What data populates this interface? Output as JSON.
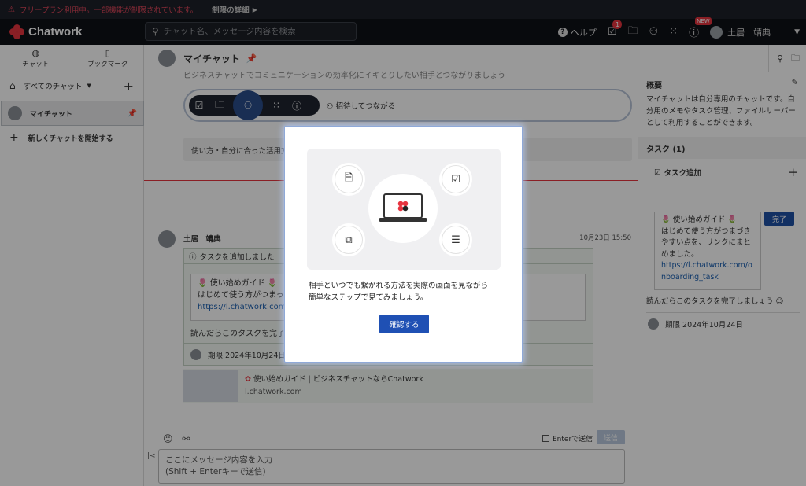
{
  "banner": {
    "warning": "フリープラン利用中。一部機能が制限されています。",
    "detail_link": "制限の詳細"
  },
  "topbar": {
    "app_name": "Chatwork",
    "search_placeholder": "チャット名、メッセージ内容を検索",
    "help_label": "ヘルプ",
    "task_badge": "1",
    "new_badge": "NEW",
    "user_name": "土居　靖典"
  },
  "sidebar": {
    "tabs": [
      {
        "label": "チャット"
      },
      {
        "label": "ブックマーク"
      }
    ],
    "filter_label": "すべてのチャット",
    "rooms": [
      {
        "name": "マイチャット"
      }
    ],
    "new_chat_label": "新しくチャットを開始する"
  },
  "chat": {
    "title": "マイチャット",
    "cut_text": "ビジネスチャットでコミュニケーションの効率化にイキとりしたい相手とつながりましょう",
    "invite_label": "招待してつながる",
    "usage_text": "使い方・自分に合った活用方",
    "message": {
      "author": "土居　靖典",
      "time": "10月23日 15:50",
      "task_header": "タスクを追加しました",
      "card_line1": "🌷 使い始めガイド 🌷",
      "card_line2": "はじめて使う方がつまっ",
      "card_link": "https://l.chatwork.com/",
      "read_text": "読んだらこのタスクを完了",
      "due": "期限 2024年10月24日"
    },
    "preview": {
      "title": "使い始めガイド | ビジネスチャットならChatwork",
      "domain": "l.chatwork.com"
    },
    "enter_send_label": "Enterで送信",
    "send_label": "送信",
    "composer_line1": "ここにメッセージ内容を入力",
    "composer_line2": "(Shift + Enterキーで送信)"
  },
  "right_panel": {
    "overview_title": "概要",
    "overview_text": "マイチャットは自分専用のチャットです。自分用のメモやタスク管理、ファイルサーバーとして利用することができます。",
    "task_title": "タスク (1)",
    "add_task_label": "タスク追加",
    "task": {
      "line1": "🌷 使い始めガイド 🌷",
      "line2": "はじめて使う方がつまづきやすい点を、リンクにまとめました。",
      "link": "https://l.chatwork.com/onboarding_task",
      "done_label": "完了",
      "read_text": "読んだらこのタスクを完了しましょう 😉",
      "due": "期限 2024年10月24日"
    }
  },
  "modal": {
    "text_line1": "相手といつでも繋がれる方法を実際の画面を見ながら",
    "text_line2": "簡単なステップで見てみましょう。",
    "confirm_label": "確認する"
  }
}
